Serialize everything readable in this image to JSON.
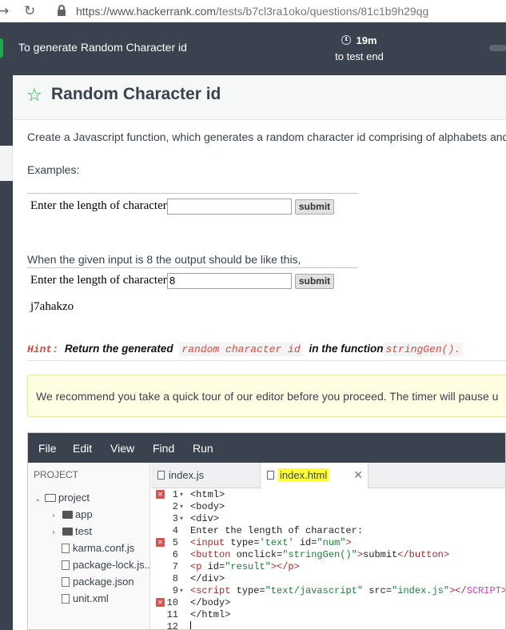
{
  "browser": {
    "url_host": "https://www.hackerrank.com",
    "url_path": "/tests/b7cl3ra1oko/questions/81c1b9h29qg"
  },
  "test_header": {
    "title": "To generate Random Character id",
    "timer_value": "19m",
    "timer_label": "to test end"
  },
  "question": {
    "title": "Random Character id",
    "description": "Create a Javascript function, which  generates a random character id comprising of alphabets and n",
    "examples_label": "Examples:",
    "demo_label": "Enter the length of character:",
    "demo_input_1": "",
    "submit_label": "submit",
    "given_text": "When the given input is 8 the output should be like this,",
    "demo_input_2": "8",
    "output_example": "j7ahakzo",
    "hint_label": "Hint:",
    "hint_text_1": "Return the generated",
    "hint_code_1": "random character id",
    "hint_text_2": "in the function",
    "hint_code_2": "stringGen()."
  },
  "notice": {
    "text": "We recommend you take a quick tour of our editor before you proceed. The timer will pause u"
  },
  "editor": {
    "menu": [
      "File",
      "Edit",
      "View",
      "Find",
      "Run"
    ],
    "project_header": "PROJECT",
    "tree": {
      "root": "project",
      "folders": [
        "app",
        "test"
      ],
      "files": [
        "karma.conf.js",
        "package-lock.js...",
        "package.json",
        "unit.xml"
      ]
    },
    "tabs": [
      "index.js",
      "index.html"
    ],
    "line_numbers": [
      "1",
      "2",
      "3",
      "4",
      "5",
      "6",
      "7",
      "8",
      "9",
      "10",
      "11",
      "12"
    ],
    "lines": {
      "l1": "<html>",
      "l2": "<body>",
      "l3": "<div>",
      "l4": "Enter the length of character:",
      "l5_a": "<input ",
      "l5_b": "type=",
      "l5_c": "'text'",
      "l5_d": " id=",
      "l5_e": "\"num\"",
      "l5_f": ">",
      "l6_a": "<button ",
      "l6_b": "onclick=",
      "l6_c": "\"stringGen()\"",
      "l6_d": ">",
      "l6_e": "submit",
      "l6_f": "</button>",
      "l7_a": "<p ",
      "l7_b": "id=",
      "l7_c": "\"result\"",
      "l7_d": "></p>",
      "l8": "</div>",
      "l9_a": "<script ",
      "l9_b": "type=",
      "l9_c": "\"text/javascript\"",
      "l9_d": " src=",
      "l9_e": "\"index.js\"",
      "l9_f": "></",
      "l9_g": "SCRIPT",
      "l9_h": ">",
      "l10": "</body>",
      "l11": "</html>",
      "l12": ""
    }
  },
  "colors": {
    "header_bg": "#39424e",
    "accent_green": "#1ba94c",
    "hint_red": "#e1473b",
    "tab_highlight": "#ffff37",
    "error_marker": "#d9534f"
  }
}
